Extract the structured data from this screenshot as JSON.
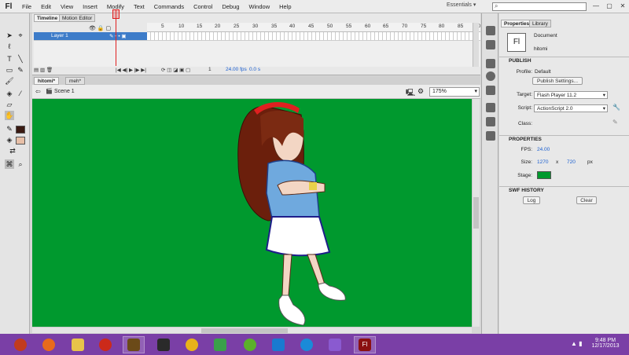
{
  "app": {
    "logo": "Fl"
  },
  "menu": [
    "File",
    "Edit",
    "View",
    "Insert",
    "Modify",
    "Text",
    "Commands",
    "Control",
    "Debug",
    "Window",
    "Help"
  ],
  "workspace": "Essentials ▾",
  "search": {
    "icon": "search-icon",
    "placeholder": ""
  },
  "window_controls": [
    "—",
    "▢",
    "✕"
  ],
  "timeline": {
    "tabs": [
      "Timeline",
      "Motion Editor"
    ],
    "ticks": [
      "5",
      "10",
      "15",
      "20",
      "25",
      "30",
      "35",
      "40",
      "45",
      "50",
      "55",
      "60",
      "65",
      "70",
      "75",
      "80",
      "85",
      "90",
      "95"
    ],
    "layer_name": "Layer 1",
    "current_frame": "1",
    "fps": "24.00 fps",
    "time": "0.0 s"
  },
  "doc_tabs": [
    "hitomi*",
    "meh*"
  ],
  "scene": {
    "label": "Scene 1",
    "zoom": "175%"
  },
  "properties": {
    "tabs": [
      "Properties",
      "Library"
    ],
    "doc_icon": "Fl",
    "doc_type": "Document",
    "doc_name": "hitomi",
    "publish_header": "PUBLISH",
    "profile_label": "Profile:",
    "profile_value": "Default",
    "publish_settings": "Publish Settings...",
    "target_label": "Target:",
    "target_value": "Flash Player 11.2",
    "script_label": "Script:",
    "script_value": "ActionScript 2.0",
    "class_label": "Class:",
    "properties_header": "PROPERTIES",
    "fps_label": "FPS:",
    "fps_value": "24.00",
    "size_label": "Size:",
    "width": "1270",
    "x": "x",
    "height": "720",
    "unit": "px",
    "stage_label": "Stage:",
    "stage_color": "#00992e",
    "swf_header": "SWF HISTORY",
    "log_button": "Log",
    "clear_button": "Clear"
  },
  "taskbar": {
    "apps": [
      "flash-swirl-icon",
      "firefox-icon",
      "file-explorer-icon",
      "ccleaner-icon",
      "archive-icon",
      "movie-icon",
      "headphones-icon",
      "puzzle-icon",
      "utorrent-icon",
      "malwarebytes-icon",
      "media-icon",
      "visual-studio-icon",
      "flash-icon"
    ],
    "time": "9:48 PM",
    "date": "12/17/2013"
  }
}
